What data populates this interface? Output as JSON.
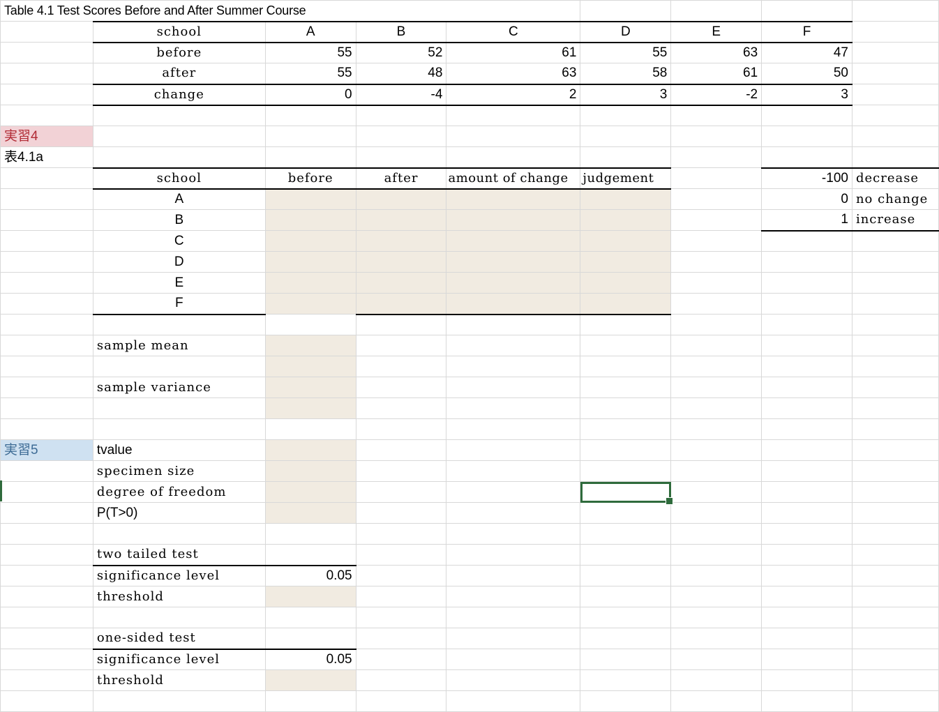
{
  "title": "Table 4.1 Test Scores Before and After Summer Course",
  "table41": {
    "header_label": "school",
    "schools": [
      "A",
      "B",
      "C",
      "D",
      "E",
      "F"
    ],
    "rows": [
      {
        "label": "before",
        "values": [
          "55",
          "52",
          "61",
          "55",
          "63",
          "47"
        ]
      },
      {
        "label": "after",
        "values": [
          "55",
          "48",
          "63",
          "58",
          "61",
          "50"
        ]
      },
      {
        "label": "change",
        "values": [
          "0",
          "-4",
          "2",
          "3",
          "-2",
          "3"
        ]
      }
    ]
  },
  "exercise4": {
    "label": "実習4",
    "table_label": "表4.1a",
    "headers": [
      "school",
      "before",
      "after",
      "amount of change",
      "judgement"
    ],
    "schools": [
      "A",
      "B",
      "C",
      "D",
      "E",
      "F"
    ],
    "sample_mean_label": "sample mean",
    "sample_variance_label": "sample variance"
  },
  "lookup": [
    {
      "value": "-100",
      "label": "decrease"
    },
    {
      "value": "0",
      "label": "no change"
    },
    {
      "value": "1",
      "label": "increase"
    }
  ],
  "exercise5": {
    "label": "実習5",
    "tvalue_label": "tvalue",
    "specimen_size_label": "specimen size",
    "dof_label": "degree of freedom",
    "p_label": "P(T>0)",
    "two_tailed": {
      "title": "two tailed test",
      "sig_label": "significance level",
      "sig_value": "0.05",
      "threshold_label": "threshold"
    },
    "one_sided": {
      "title": "one-sided test",
      "sig_label": "significance level",
      "sig_value": "0.05",
      "threshold_label": "threshold"
    }
  },
  "colors": {
    "input_fill": "#f1ebe1",
    "pink_label": "#f2d2d6",
    "blue_label": "#cfe1f1",
    "selection": "#2f6b3c"
  }
}
